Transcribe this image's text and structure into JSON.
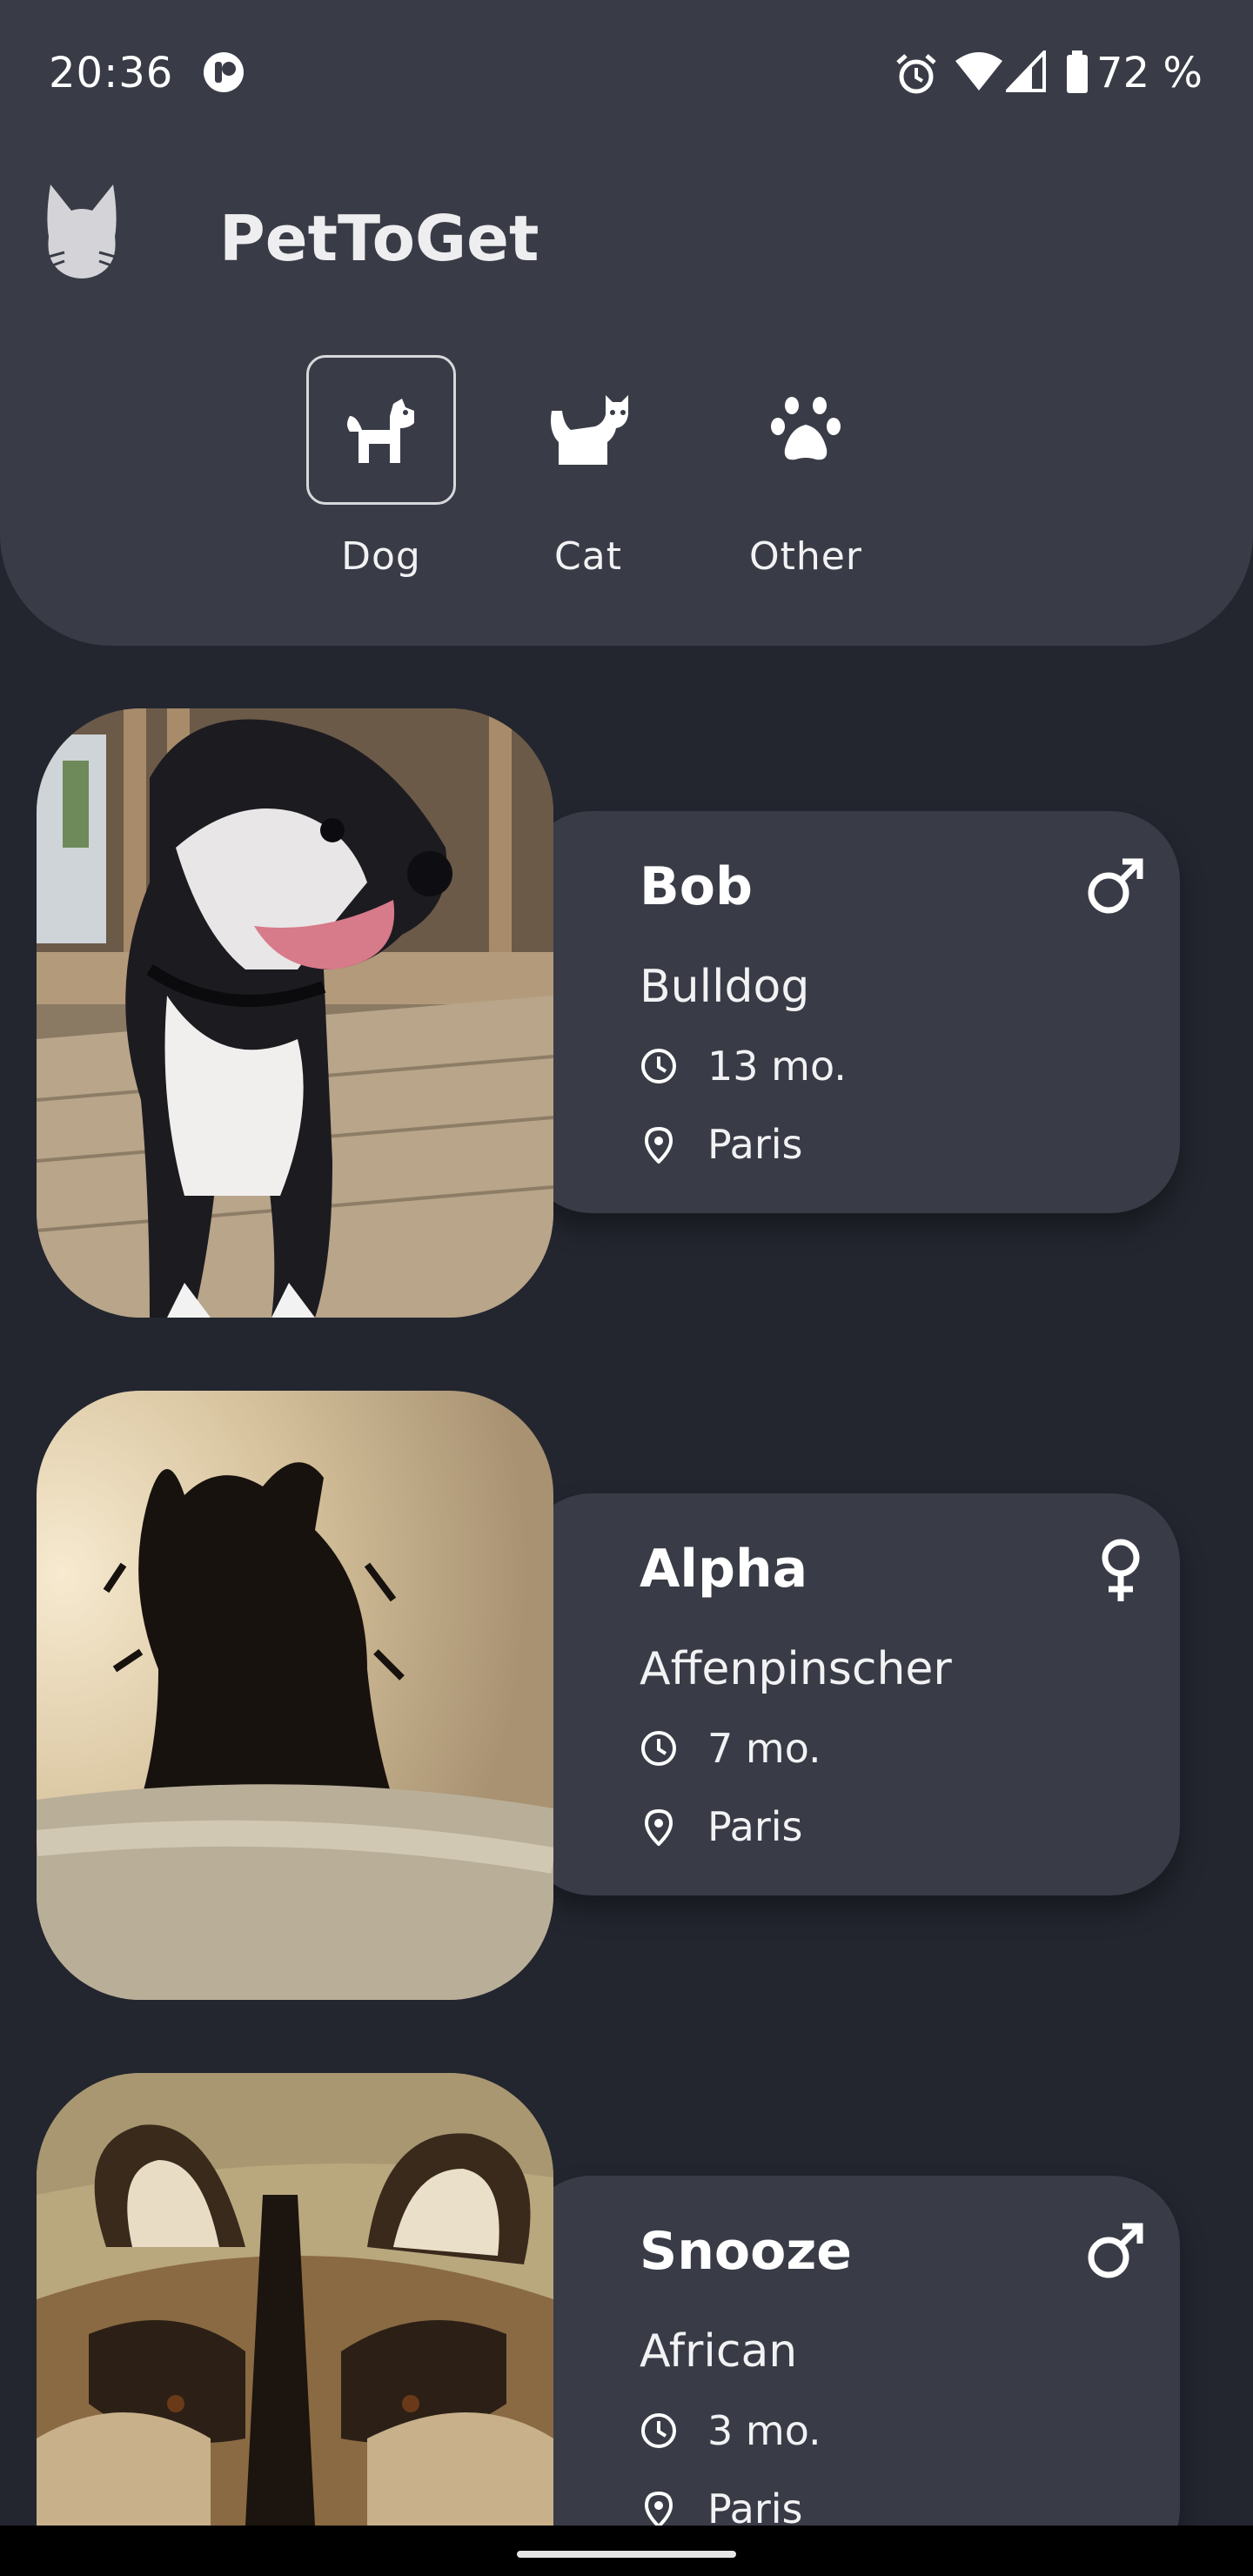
{
  "status_bar": {
    "time": "20:36",
    "battery": "72 %",
    "icons": [
      "app-notification-icon",
      "alarm-icon",
      "wifi-icon",
      "signal-icon",
      "battery-icon"
    ]
  },
  "header": {
    "logo_icon": "cat-head-icon",
    "title": "PetToGet",
    "categories": [
      {
        "label": "Dog",
        "icon": "dog-icon",
        "selected": true
      },
      {
        "label": "Cat",
        "icon": "cat-icon",
        "selected": false
      },
      {
        "label": "Other",
        "icon": "paw-icon",
        "selected": false
      }
    ]
  },
  "pets": [
    {
      "name": "Bob",
      "breed": "Bulldog",
      "age": "13 mo.",
      "location": "Paris",
      "gender": "male"
    },
    {
      "name": "Alpha",
      "breed": "Affenpinscher",
      "age": "7 mo.",
      "location": "Paris",
      "gender": "female"
    },
    {
      "name": "Snooze",
      "breed": "African",
      "age": "3 mo.",
      "location": "Paris",
      "gender": "male"
    }
  ],
  "colors": {
    "background": "#23262f",
    "surface": "#393c46",
    "text": "#ffffff"
  }
}
